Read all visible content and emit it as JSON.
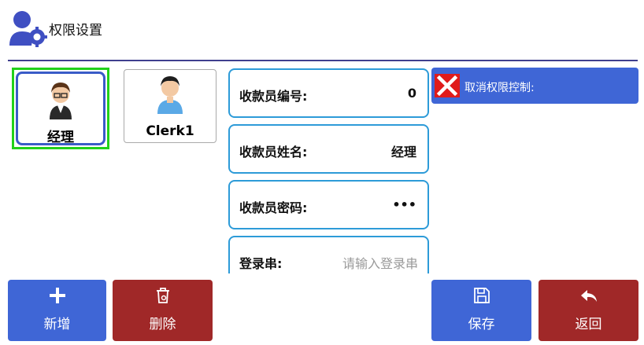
{
  "header": {
    "title": "权限设置",
    "icon": "user-gear-icon"
  },
  "users": [
    {
      "name": "经理",
      "selected": true,
      "icon": "manager-avatar-icon"
    },
    {
      "name": "Clerk1",
      "selected": false,
      "icon": "clerk-avatar-icon"
    }
  ],
  "fields": {
    "cashier_id": {
      "label": "收款员编号:",
      "value": "0"
    },
    "cashier_name": {
      "label": "收款员姓名:",
      "value": "经理"
    },
    "cashier_password": {
      "label": "收款员密码:",
      "value": "•••"
    },
    "login_string": {
      "label": "登录串:",
      "placeholder": "请输入登录串"
    }
  },
  "permission": {
    "label": "取消权限控制:",
    "icon": "red-x-icon"
  },
  "buttons": {
    "add": {
      "label": "新增",
      "icon": "plus-icon"
    },
    "delete": {
      "label": "删除",
      "icon": "trash-icon"
    },
    "save": {
      "label": "保存",
      "icon": "save-icon"
    },
    "back": {
      "label": "返回",
      "icon": "back-arrow-icon"
    }
  },
  "colors": {
    "primary": "#3f66d6",
    "danger": "#a02828",
    "field_border": "#2d9bd8",
    "selected": "#22d11a"
  }
}
